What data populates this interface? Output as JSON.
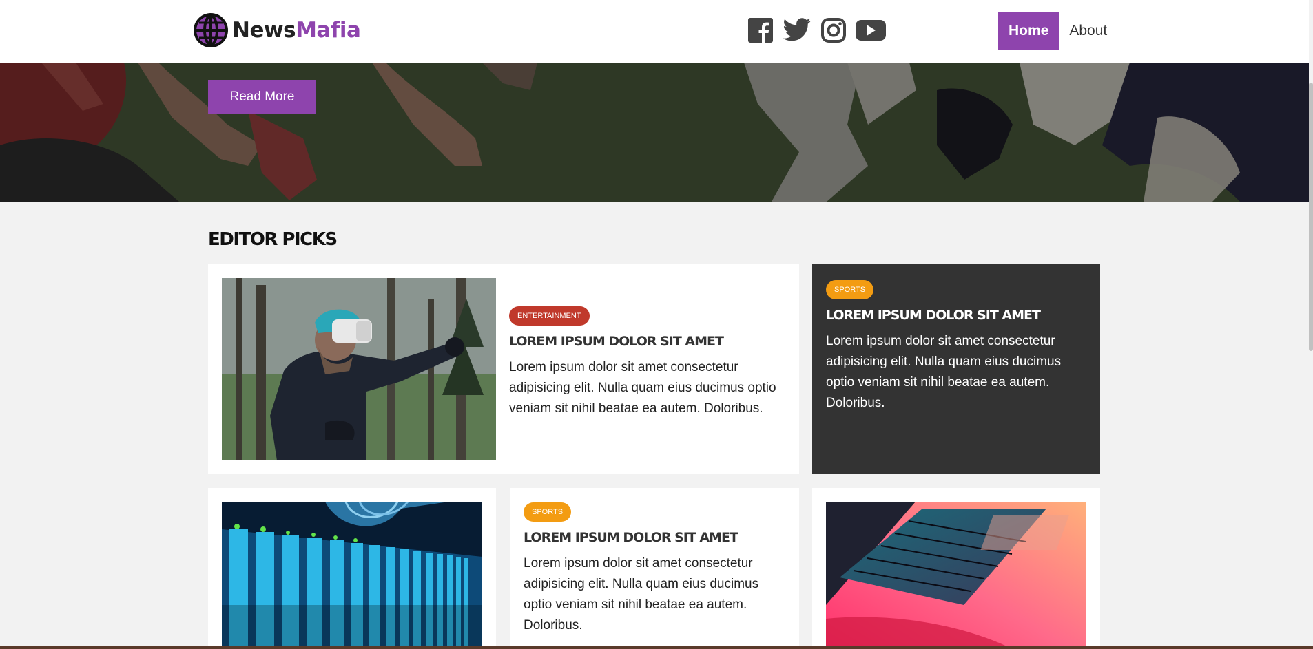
{
  "brand": {
    "name_part1": "News",
    "name_part2": "Mafia",
    "accent": "#8e44ad"
  },
  "socials": [
    {
      "icon": "facebook-icon"
    },
    {
      "icon": "twitter-icon"
    },
    {
      "icon": "instagram-icon"
    },
    {
      "icon": "youtube-icon"
    }
  ],
  "nav": {
    "home": "Home",
    "about": "About"
  },
  "hero": {
    "button": "Read More"
  },
  "section": {
    "title": "EDITOR PICKS"
  },
  "cards": {
    "featured": {
      "badge": "ENTERTAINMENT",
      "title": "LOREM IPSUM DOLOR SIT AMET",
      "text": "Lorem ipsum dolor sit amet consectetur adipisicing elit. Nulla quam eius ducimus optio veniam sit nihil beatae ea autem. Doloribus."
    },
    "dark": {
      "badge": "SPORTS",
      "title": "LOREM IPSUM DOLOR SIT AMET",
      "text": "Lorem ipsum dolor sit amet consectetur adipisicing elit. Nulla quam eius ducimus optio veniam sit nihil beatae ea autem. Doloribus."
    },
    "middle": {
      "badge": "SPORTS",
      "title": "LOREM IPSUM DOLOR SIT AMET",
      "text": "Lorem ipsum dolor sit amet consectetur adipisicing elit. Nulla quam eius ducimus optio veniam sit nihil beatae ea autem. Doloribus."
    }
  },
  "colors": {
    "badge_entertainment": "#c0392b",
    "badge_sports": "#f39c12",
    "dark_card": "#333333"
  }
}
